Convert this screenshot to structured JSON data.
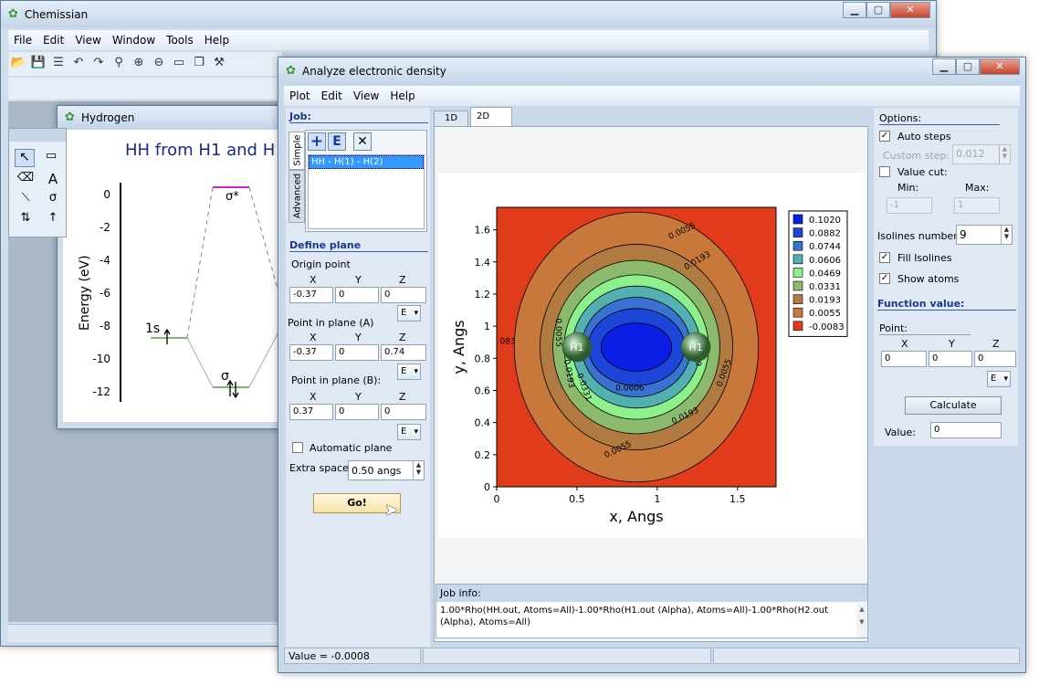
{
  "main_window": {
    "title": "Chemissian",
    "menu": [
      "File",
      "Edit",
      "View",
      "Window",
      "Tools",
      "Help"
    ],
    "window_buttons": {
      "minimize": "▁",
      "maximize": "▢",
      "close": "✕"
    }
  },
  "hydrogen_window": {
    "title": "Hydrogen",
    "diagram_title": "HH from H1 and H",
    "ylabel": "Energy (eV)",
    "yticks": [
      "0",
      "-2",
      "-4",
      "-6",
      "-8",
      "-10",
      "-12"
    ],
    "labels": {
      "sigma_star": "σ*",
      "one_s": "1s",
      "sigma": "σ"
    }
  },
  "draw_tools": {
    "select": "↖",
    "text": "A",
    "sigma": "σ"
  },
  "analyze_window": {
    "title": "Analyze electronic density",
    "menu": [
      "Plot",
      "Edit",
      "View",
      "Help"
    ],
    "job_section": "Job:",
    "side_tabs": {
      "simple": "Simple",
      "advanced": "Advanced"
    },
    "job_toolbar": {
      "add": "+",
      "edit": "E",
      "delete": "✕"
    },
    "job_items": [
      "HH - H(1) - H(2)"
    ],
    "define_plane": "Define plane",
    "origin_point": {
      "label": "Origin point",
      "x": "-0.37",
      "y": "0",
      "z": "0"
    },
    "point_a": {
      "label": "Point in plane (A)",
      "x": "-0.37",
      "y": "0",
      "z": "0.74"
    },
    "point_b": {
      "label": "Point in plane (B):",
      "x": "0.37",
      "y": "0",
      "z": "0"
    },
    "axis_headers": {
      "x": "X",
      "y": "Y",
      "z": "Z"
    },
    "e_button": "E",
    "automatic_plane": "Automatic plane",
    "extra_space": {
      "label": "Extra space:",
      "value": "0.50 angs"
    },
    "go_button": "Go!",
    "tabs": [
      "1D",
      "2D"
    ],
    "job_info": {
      "label": "Job info:",
      "text": "1.00*Rho(HH.out, Atoms=All)-1.00*Rho(H1.out (Alpha), Atoms=All)-1.00*Rho(H2.out (Alpha), Atoms=All)"
    },
    "status": "Value = -0.0008",
    "options": {
      "label": "Options:",
      "auto_steps": "Auto steps",
      "custom_step": {
        "label": "Custom step:",
        "value": "0.012"
      },
      "value_cut": "Value cut:",
      "min": {
        "label": "Min:",
        "value": "-1"
      },
      "max": {
        "label": "Max:",
        "value": "1"
      },
      "isolines": {
        "label": "Isolines number:",
        "value": "9"
      },
      "fill_isolines": "Fill Isolines",
      "show_atoms": "Show atoms",
      "check_mark": "✓"
    },
    "function_value": {
      "label": "Function value:",
      "point": "Point:",
      "x": "0",
      "y": "0",
      "z": "0",
      "calculate": "Calculate",
      "value_label": "Value:",
      "value": "0"
    }
  },
  "chart_data": {
    "type": "heatmap",
    "xlabel": "x, Angs",
    "ylabel": "y, Angs",
    "xticks": [
      "0",
      "0.5",
      "1",
      "1.5"
    ],
    "yticks": [
      "0",
      "0.2",
      "0.4",
      "0.6",
      "0.8",
      "1",
      "1.2",
      "1.4",
      "1.6"
    ],
    "xlim": [
      0,
      1.74
    ],
    "ylim": [
      0,
      1.74
    ],
    "levels": [
      "0.1020",
      "0.0882",
      "0.0744",
      "0.0606",
      "0.0469",
      "0.0331",
      "0.0193",
      "0.0055",
      "-0.0083"
    ],
    "level_colors": [
      "#0a1ee6",
      "#1c46d8",
      "#3a72d0",
      "#52b0b0",
      "#8cf08c",
      "#8cba6c",
      "#b07a40",
      "#c8783a",
      "#e03c1c"
    ],
    "isoline_labels": [
      "0.0055",
      "0.0193",
      "0.0055",
      "0.0193",
      "0.0331",
      "0.0606",
      "0.0469",
      "0.0193",
      "0.0055",
      "0.0055",
      "083"
    ],
    "atoms": [
      {
        "label": "H1",
        "x": 0.5,
        "y": 0.87
      },
      {
        "label": "H1",
        "x": 1.24,
        "y": 0.87
      }
    ]
  }
}
